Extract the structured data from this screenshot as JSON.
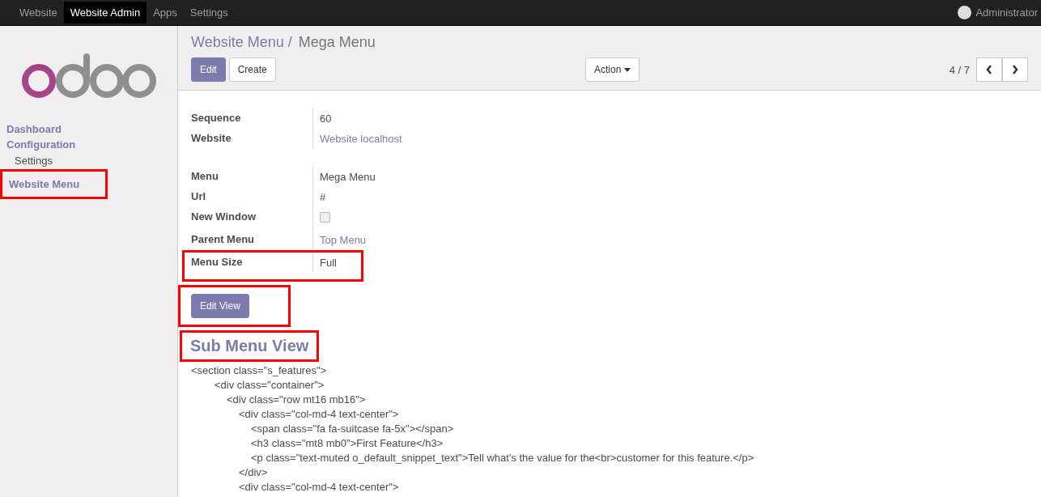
{
  "topbar": {
    "menus": [
      {
        "label": "Website",
        "selected": false
      },
      {
        "label": "Website Admin",
        "selected": true
      },
      {
        "label": "Apps",
        "selected": false
      },
      {
        "label": "Settings",
        "selected": false
      }
    ],
    "user": "Administrator"
  },
  "sidebar": {
    "items": [
      {
        "label": "Dashboard",
        "kind": "header",
        "highlighted": false
      },
      {
        "label": "Configuration",
        "kind": "header",
        "highlighted": false
      },
      {
        "label": "Settings",
        "kind": "sub",
        "highlighted": false
      },
      {
        "label": "Website Menu",
        "kind": "header",
        "highlighted": true
      }
    ]
  },
  "breadcrumb": {
    "parent": "Website Menu /",
    "current": "Mega Menu"
  },
  "buttons": [
    {
      "label": "Edit",
      "kind": "primary"
    },
    {
      "label": "Create",
      "kind": "default"
    }
  ],
  "action": "Action",
  "pager": "4 / 7",
  "groups": [
    [
      {
        "label": "Sequence",
        "value": "60",
        "kind": "text",
        "highlighted": false
      },
      {
        "label": "Website",
        "value": "Website localhost",
        "kind": "link",
        "highlighted": false
      }
    ],
    [
      {
        "label": "Menu",
        "value": "Mega Menu",
        "kind": "text",
        "highlighted": false
      },
      {
        "label": "Url",
        "value": "#",
        "kind": "text",
        "highlighted": false
      },
      {
        "label": "New Window",
        "checked": false,
        "kind": "checkbox",
        "highlighted": false
      },
      {
        "label": "Parent Menu",
        "value": "Top Menu",
        "kind": "link",
        "highlighted": false
      },
      {
        "label": "Menu Size",
        "value": "Full",
        "kind": "text",
        "highlighted": true
      }
    ]
  ],
  "edit_view": {
    "label": "Edit View",
    "highlighted": true
  },
  "section": {
    "title": "Sub Menu View",
    "highlighted": true
  },
  "code": [
    {
      "text": "<section class=\"s_features\">",
      "children": [
        {
          "text": "<div class=\"container\">",
          "children": [
            {
              "text": "<div class=\"row mt16 mb16\">",
              "children": [
                {
                  "text": "<div class=\"col-md-4 text-center\">",
                  "children": [
                    {
                      "text": "<span class=\"fa fa-suitcase fa-5x\"></span>"
                    },
                    {
                      "text": "<h3 class=\"mt8 mb0\">First Feature</h3>"
                    },
                    {
                      "text": "<p class=\"text-muted o_default_snippet_text\">Tell what's the value for the<br>customer for this feature.</p>"
                    }
                  ]
                },
                {
                  "text": "</div>"
                },
                {
                  "text": "<div class=\"col-md-4 text-center\">"
                }
              ]
            }
          ]
        }
      ]
    }
  ]
}
